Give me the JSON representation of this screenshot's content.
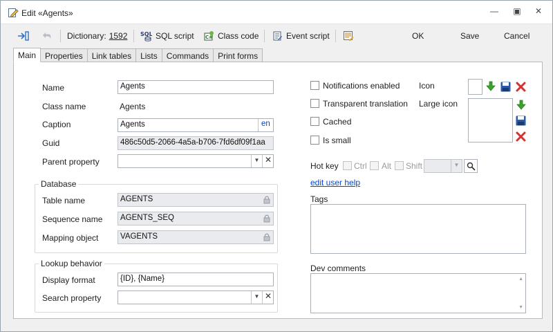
{
  "window": {
    "title": "Edit «Agents»",
    "minimize_glyph": "—",
    "maximize_glyph": "▣",
    "close_glyph": "✕"
  },
  "toolbar": {
    "dictionary_label": "Dictionary:",
    "dictionary_value": "1592",
    "sql_script": "SQL script",
    "class_code": "Class code",
    "event_script": "Event script",
    "ok": "OK",
    "save": "Save",
    "cancel": "Cancel"
  },
  "tabs": [
    "Main",
    "Properties",
    "Link tables",
    "Lists",
    "Commands",
    "Print forms"
  ],
  "main": {
    "name_label": "Name",
    "name_value": "Agents",
    "class_name_label": "Class name",
    "class_name_value": "Agents",
    "caption_label": "Caption",
    "caption_value": "Agents",
    "caption_lang": "en",
    "guid_label": "Guid",
    "guid_value": "486c50d5-2066-4a5a-b706-7fd6df09f1aa",
    "parent_label": "Parent property",
    "parent_value": "",
    "database": {
      "title": "Database",
      "table_label": "Table name",
      "table_value": "AGENTS",
      "sequence_label": "Sequence name",
      "sequence_value": "AGENTS_SEQ",
      "mapping_label": "Mapping object",
      "mapping_value": "VAGENTS"
    },
    "lookup": {
      "title": "Lookup behavior",
      "display_label": "Display format",
      "display_value": "{ID}, {Name}",
      "search_label": "Search property",
      "search_value": ""
    }
  },
  "options": {
    "notifications": "Notifications enabled",
    "transparent": "Transparent translation",
    "cached": "Cached",
    "is_small": "Is small",
    "icon_label": "Icon",
    "large_icon_label": "Large icon",
    "hotkey_label": "Hot key",
    "ctrl": "Ctrl",
    "alt": "Alt",
    "shift": "Shift",
    "edit_user_help": "edit user help",
    "tags_label": "Tags",
    "dev_comments_label": "Dev comments"
  },
  "colors": {
    "accent": "#0b45c9",
    "delete_red": "#d83030",
    "import_green": "#3aa32a",
    "save_blue": "#2b5aa8"
  }
}
